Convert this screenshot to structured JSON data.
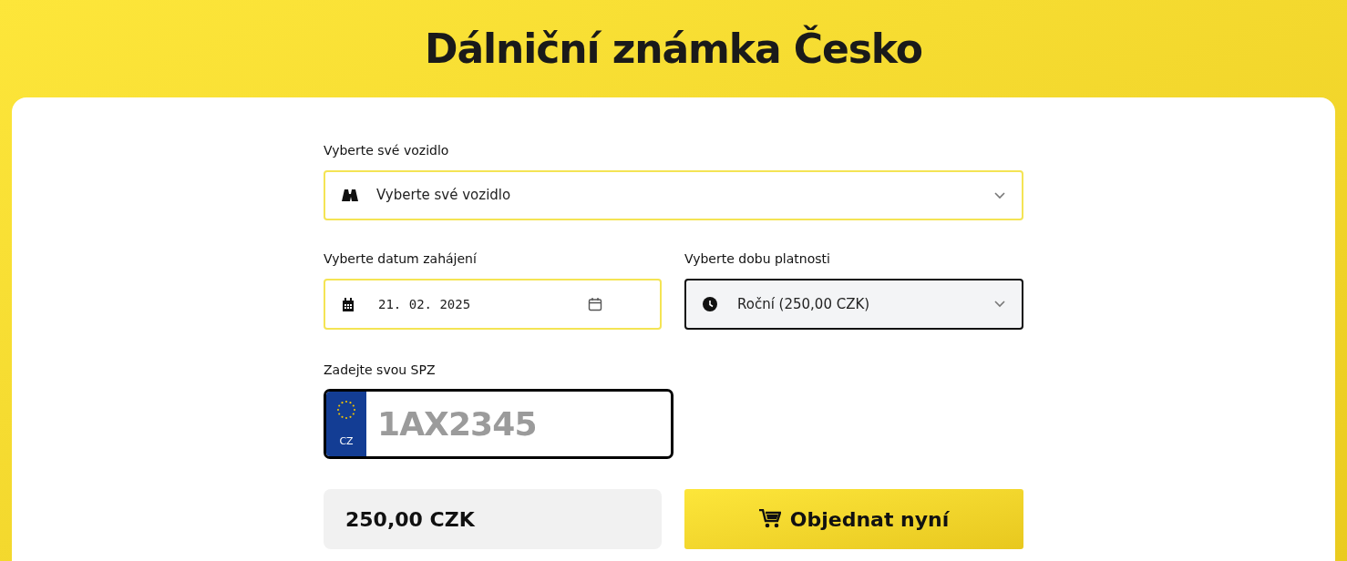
{
  "title": "Dálniční známka Česko",
  "vehicle": {
    "label": "Vyberte své vozidlo",
    "value": "Vyberte své vozidlo",
    "focused": false
  },
  "start_date": {
    "label": "Vyberte datum zahájení",
    "value": "21. 02. 2025",
    "focused": false
  },
  "validity": {
    "label": "Vyberte dobu platnosti",
    "value": "Roční (250,00 CZK)",
    "focused": true
  },
  "plate": {
    "label": "Zadejte svou SPZ",
    "country": "CZ",
    "placeholder": "1AX2345"
  },
  "price": "250,00 CZK",
  "order_button": "Objednat nyní"
}
